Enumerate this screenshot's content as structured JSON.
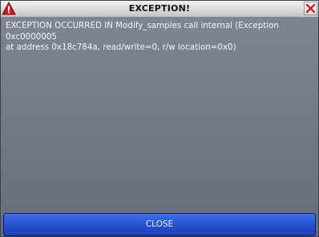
{
  "window": {
    "title": "EXCEPTION!",
    "warning_icon": "warning-triangle-icon",
    "close_icon": "close-x-icon"
  },
  "message": "EXCEPTION OCCURRED IN Modify_samples call internal (Exception 0xc0000005\nat address 0x18c784a, read/write=0, r/w location=0x0)",
  "buttons": {
    "close_label": "CLOSE"
  },
  "colors": {
    "accent_button": "#2653d2",
    "warning_red": "#d11d1d",
    "close_red": "#cf2222"
  }
}
